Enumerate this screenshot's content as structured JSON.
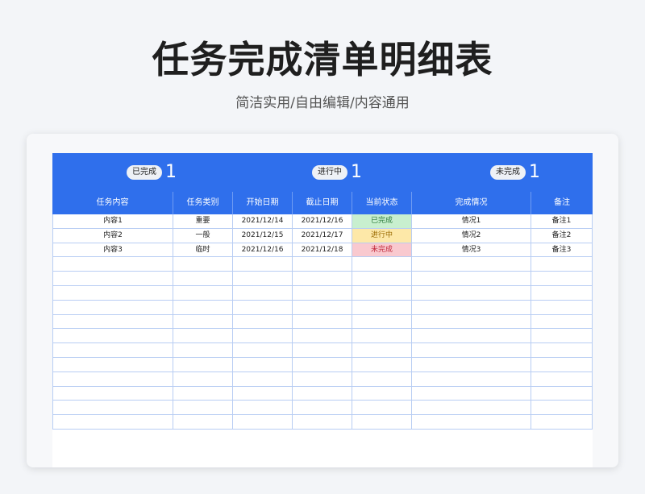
{
  "title": "任务完成清单明细表",
  "subtitle": "简洁实用/自由编辑/内容通用",
  "summary": [
    {
      "label": "已完成",
      "count": "1"
    },
    {
      "label": "进行中",
      "count": "1"
    },
    {
      "label": "未完成",
      "count": "1"
    }
  ],
  "columns": [
    "任务内容",
    "任务类别",
    "开始日期",
    "截止日期",
    "当前状态",
    "完成情况",
    "备注"
  ],
  "rows": [
    {
      "content": "内容1",
      "category": "重要",
      "start": "2021/12/14",
      "end": "2021/12/16",
      "status": "已完成",
      "progress": "情况1",
      "note": "备注1"
    },
    {
      "content": "内容2",
      "category": "一般",
      "start": "2021/12/15",
      "end": "2021/12/17",
      "status": "进行中",
      "progress": "情况2",
      "note": "备注2"
    },
    {
      "content": "内容3",
      "category": "临时",
      "start": "2021/12/16",
      "end": "2021/12/18",
      "status": "未完成",
      "progress": "情况3",
      "note": "备注3"
    }
  ],
  "empty_row_count": 12,
  "colors": {
    "header_blue": "#2f6fec",
    "done": "#c8efcf",
    "in_progress": "#fde8a8",
    "not_done": "#f9c9cf"
  }
}
